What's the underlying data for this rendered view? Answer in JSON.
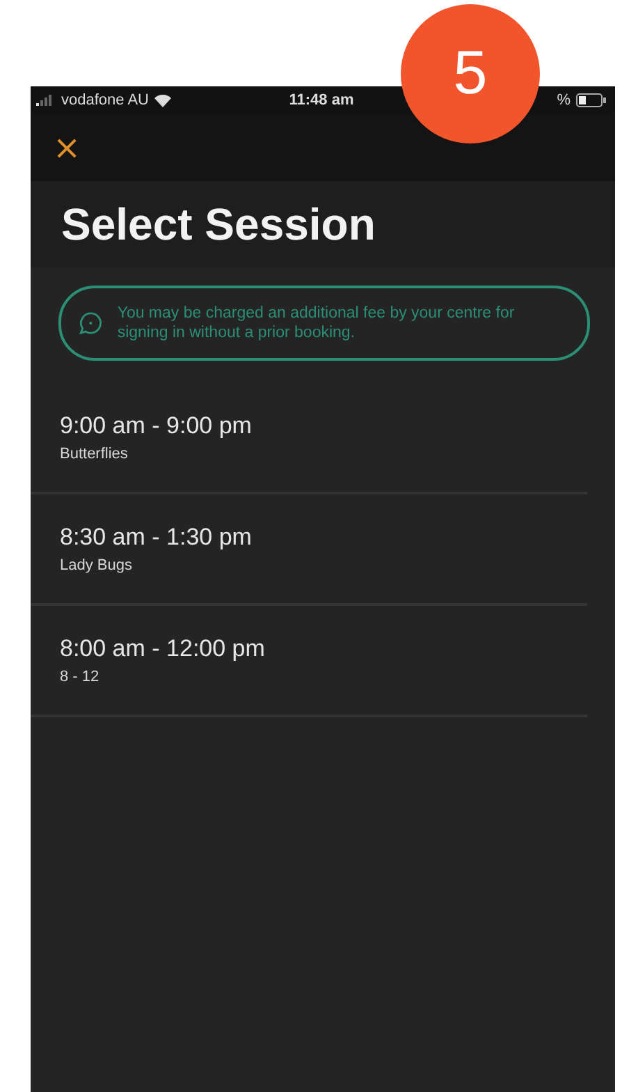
{
  "status_bar": {
    "carrier": "vodafone AU",
    "time": "11:48 am",
    "battery": "%"
  },
  "badge": "5",
  "close": "×",
  "title": "Select Session",
  "notice": "You may be charged an additional fee by your centre for signing in without a prior booking.",
  "sessions": [
    {
      "time": "9:00 am - 9:00 pm",
      "room": "Butterflies"
    },
    {
      "time": "8:30 am - 1:30 pm",
      "room": "Lady Bugs"
    },
    {
      "time": "8:00 am - 12:00 pm",
      "room": "8 - 12"
    }
  ]
}
